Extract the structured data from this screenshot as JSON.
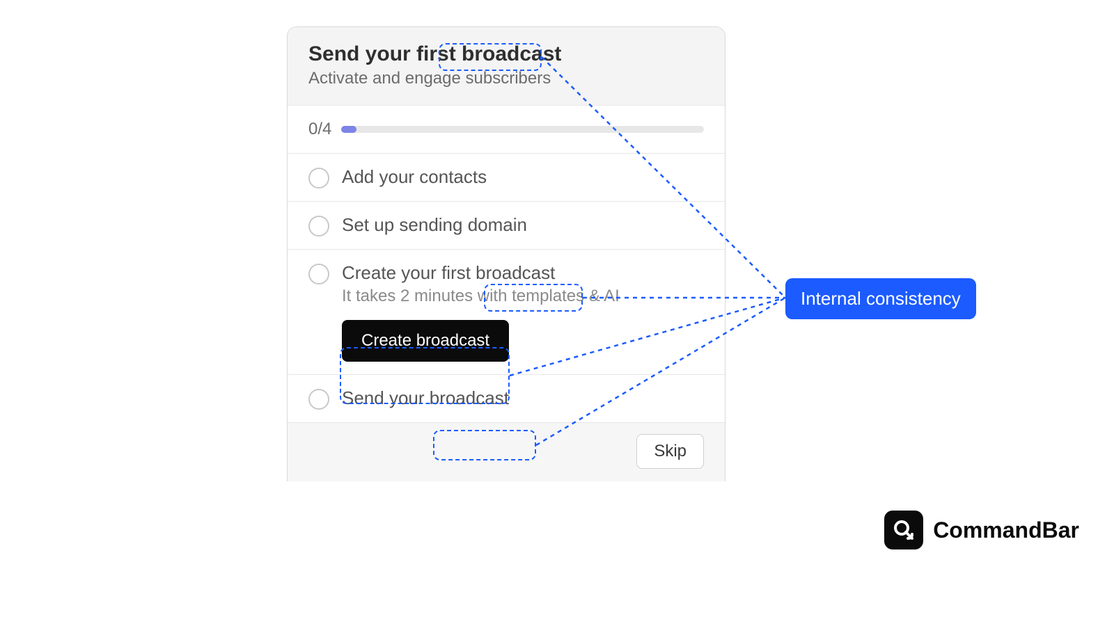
{
  "card": {
    "title": "Send your first broadcast",
    "subtitle": "Activate and engage subscribers",
    "progress_label": "0/4",
    "steps": [
      {
        "title": "Add your contacts"
      },
      {
        "title": "Set up sending domain"
      },
      {
        "title": "Create your first broadcast",
        "sub": "It takes 2 minutes with templates & AI",
        "cta": "Create broadcast"
      },
      {
        "title": "Send your broadcast"
      }
    ],
    "skip_label": "Skip"
  },
  "annotation": {
    "label": "Internal consistency"
  },
  "watermark": {
    "text": "CommandBar"
  },
  "colors": {
    "accent_dashed": "#1b5bff",
    "progress_fill": "#7d84e6"
  }
}
